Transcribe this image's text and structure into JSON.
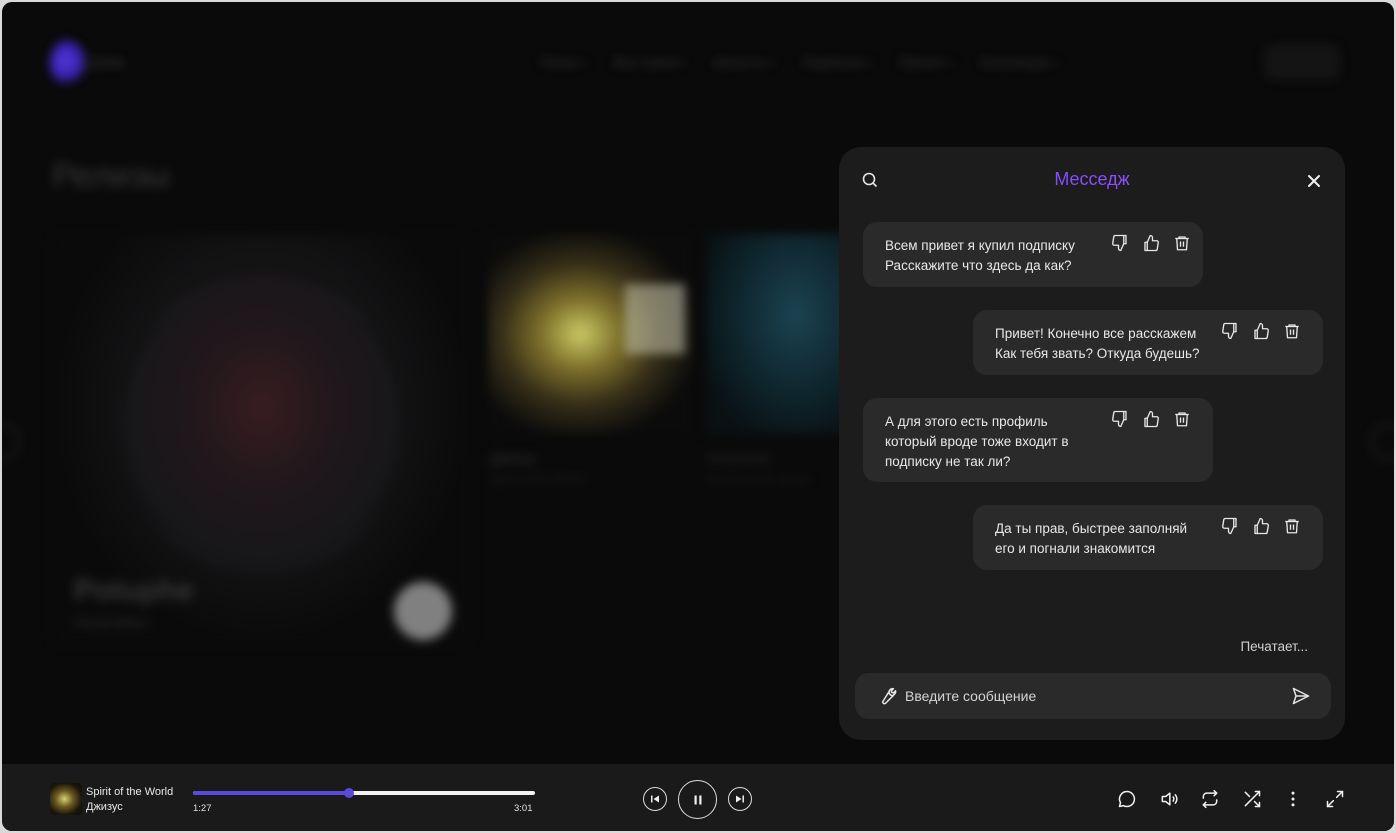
{
  "background": {
    "logo_text": "Loona",
    "nav": [
      "Поиск",
      "Все треки",
      "Артисты",
      "Подписки",
      "Проект",
      "Коллекция"
    ],
    "section_title": "Релизы",
    "featured": {
      "title": "Potuphe",
      "subtitle": "Неактивно"
    },
    "cards": [
      {
        "title": "Джизус",
        "subtitle": "Spirit of the World"
      },
      {
        "title": "Mirabilerik",
        "subtitle": "Moviez even space"
      }
    ]
  },
  "chat": {
    "title": "Месседж",
    "messages": [
      {
        "lines": [
          "Всем привет я купил подписку",
          "Расскажите что здесь да как?"
        ]
      },
      {
        "lines": [
          "Привет! Конечно все расскажем",
          "Как тебя звать? Откуда будешь?"
        ]
      },
      {
        "lines": [
          "А для этого есть профиль",
          "который вроде тоже входит в",
          "подписку не так ли?"
        ]
      },
      {
        "lines": [
          "Да ты прав, быстрее заполняй",
          "его и погнали знакомится"
        ]
      }
    ],
    "typing": "Печатает...",
    "input_placeholder": "Введите сообщение",
    "input_value": ""
  },
  "player": {
    "track": "Spirit of the World",
    "artist": "Джизус",
    "current_time": "1:27",
    "total_time": "3:01",
    "progress": 0.456
  },
  "icons": {
    "accent": "#5a4ad9",
    "title_gradient": [
      "#6a4dff",
      "#b04bff"
    ]
  }
}
